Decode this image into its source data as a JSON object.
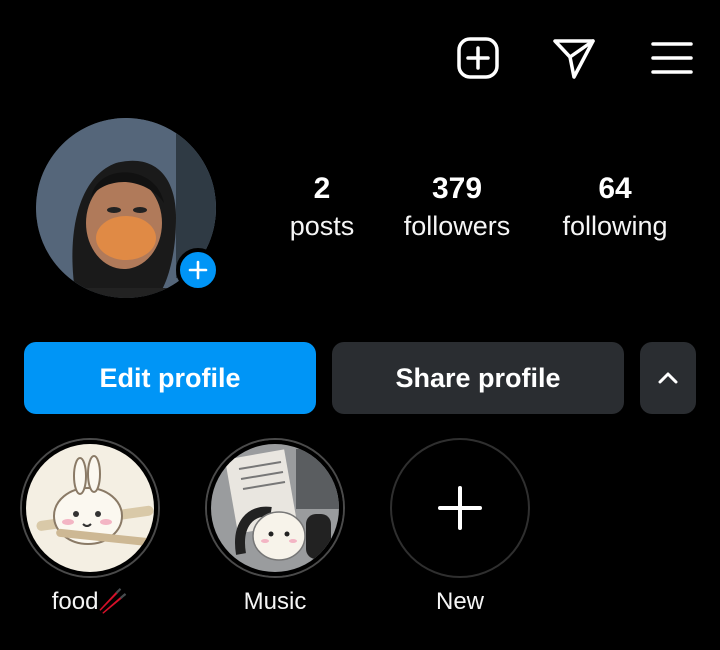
{
  "header": {
    "icons": [
      "plus-square-icon",
      "send-icon",
      "menu-icon"
    ]
  },
  "profile": {
    "avatar": "profile-photo",
    "stats": {
      "posts": {
        "value": "2",
        "label": "posts"
      },
      "followers": {
        "value": "379",
        "label": "followers"
      },
      "following": {
        "value": "64",
        "label": "following"
      }
    }
  },
  "actions": {
    "edit_label": "Edit profile",
    "share_label": "Share profile",
    "expand_icon": "chevron-up-icon"
  },
  "highlights": [
    {
      "label": "food🥢"
    },
    {
      "label": "Music"
    },
    {
      "label": "New"
    }
  ],
  "colors": {
    "accent": "#0095f6",
    "button_dark": "#2a2d31",
    "background": "#000000",
    "text": "#ffffff"
  }
}
